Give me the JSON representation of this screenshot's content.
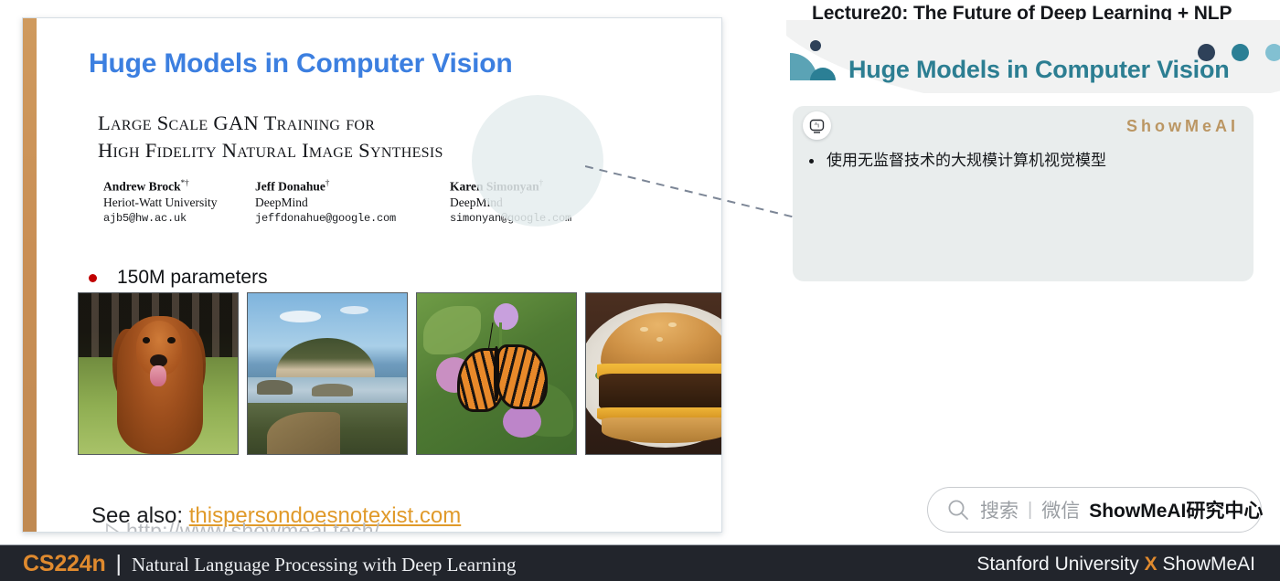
{
  "header": {
    "lecture_title": "Lecture20:  The Future of Deep Learning + NLP",
    "panel_title": "Huge Models in Computer Vision",
    "logo_icon": "showmeai-logo-icon",
    "dot_colors": [
      "#2e4159",
      "#2b7f95",
      "#82c0d2"
    ],
    "accent_color": "#2c7e92"
  },
  "slide": {
    "title": "Huge Models in Computer Vision",
    "title_color": "#3c7fe0",
    "accent_bar_color": "#cf9a5e",
    "paper_title": "Large Scale GAN Training for\nHigh Fidelity Natural Image Synthesis",
    "authors": [
      {
        "name": "Andrew Brock",
        "sup": "*†",
        "affiliation": "Heriot-Watt University",
        "email": "ajb5@hw.ac.uk"
      },
      {
        "name": "Jeff Donahue",
        "sup": "†",
        "affiliation": "DeepMind",
        "email": "jeffdonahue@google.com"
      },
      {
        "name": "Karen Simonyan",
        "sup": "†",
        "affiliation": "DeepMind",
        "email": "simonyan@google.com"
      }
    ],
    "bullet": "150M parameters",
    "bullet_color": "#c00000",
    "thumbnails": [
      {
        "name": "dog-sample-image"
      },
      {
        "name": "coastline-sample-image"
      },
      {
        "name": "butterfly-sample-image"
      },
      {
        "name": "burger-sample-image"
      }
    ],
    "see_also_label": "See also: ",
    "see_also_link": "thispersondoesnotexist.com",
    "see_also_link_color": "#e09a2a",
    "watermark_url": "http://www.showmeai.tech/",
    "cursor_icon": "mouse-pointer-icon"
  },
  "note_card": {
    "ai_badge_icon": "ai-robot-icon",
    "watermark": "ShowMeAI",
    "watermark_color": "#bb9663",
    "bullets": [
      "使用无监督技术的大规模计算机视觉模型"
    ]
  },
  "search": {
    "search_icon": "search-icon",
    "cn_label": "搜索",
    "separator": "|",
    "wechat_label": "微信",
    "brand": "ShowMeAI研究中心"
  },
  "bottom_bar": {
    "course_code": "CS224n",
    "divider": "|",
    "course_name": "Natural Language Processing with Deep Learning",
    "credit_left": "Stanford University",
    "credit_x": "X",
    "credit_right": "ShowMeAI",
    "bg_color": "#22252c",
    "course_color": "#e08a2e"
  }
}
